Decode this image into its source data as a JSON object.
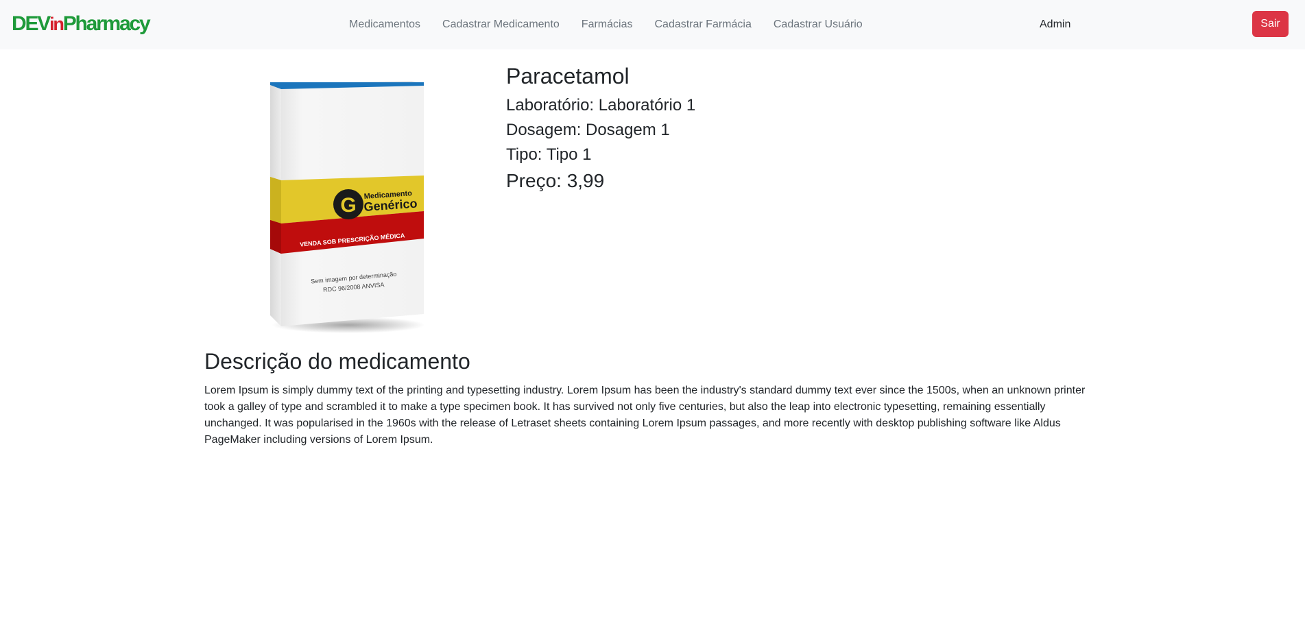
{
  "brand": {
    "part1": "DEV",
    "part2": "in",
    "part3": "Pharmacy"
  },
  "nav": {
    "items": [
      {
        "label": "Medicamentos"
      },
      {
        "label": "Cadastrar Medicamento"
      },
      {
        "label": "Farmácias"
      },
      {
        "label": "Cadastrar Farmácia"
      },
      {
        "label": "Cadastrar Usuário"
      }
    ],
    "user": "Admin",
    "logout_label": "Sair"
  },
  "colors": {
    "brand_green": "#1e9a3a",
    "brand_red": "#d5202c",
    "danger": "#dc3545",
    "navbar_bg": "#f8f9fa"
  },
  "product": {
    "name": "Paracetamol",
    "laboratory": "Laboratório: Laboratório 1",
    "dosage": "Dosagem: Dosagem 1",
    "type": "Tipo: Tipo 1",
    "price": "Preço: 3,99",
    "box": {
      "logo_letter": "G",
      "logo_line1": "Medicamento",
      "logo_line2": "Genérico",
      "band_text": "VENDA SOB PRESCRIÇÃO MÉDICA",
      "note_line1": "Sem imagem por determinação",
      "note_line2": "RDC 96/2008 ANVISA"
    }
  },
  "description": {
    "title": "Descrição do medicamento",
    "text": "Lorem Ipsum is simply dummy text of the printing and typesetting industry. Lorem Ipsum has been the industry's standard dummy text ever since the 1500s, when an unknown printer took a galley of type and scrambled it to make a type specimen book. It has survived not only five centuries, but also the leap into electronic typesetting, remaining essentially unchanged. It was popularised in the 1960s with the release of Letraset sheets containing Lorem Ipsum passages, and more recently with desktop publishing software like Aldus PageMaker including versions of Lorem Ipsum."
  }
}
